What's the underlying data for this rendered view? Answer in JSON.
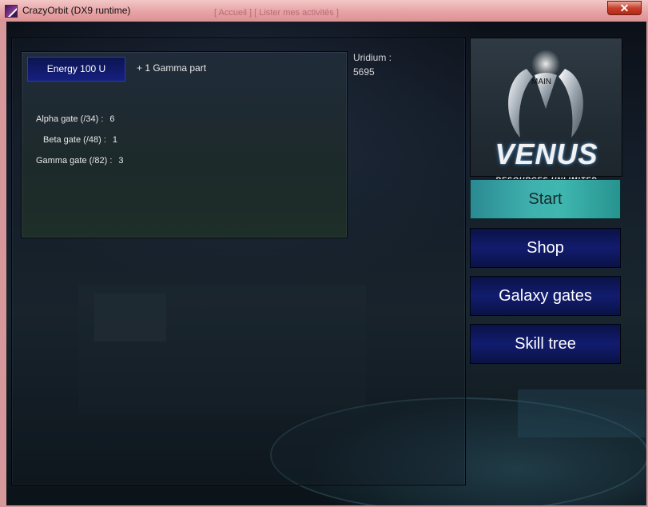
{
  "window": {
    "title": "CrazyOrbit (DX9 runtime)",
    "background_text": "[ Accueil ]  [ Lister mes activités ]",
    "close_symbol": "✕"
  },
  "reward": {
    "button_label": "Energy 100 U",
    "text": "+ 1 Gamma part"
  },
  "gates": [
    {
      "label": "Alpha gate (/34) :",
      "value": "6"
    },
    {
      "label": "Beta gate (/48) :",
      "value": "1"
    },
    {
      "label": "Gamma gate (/82) :",
      "value": "3"
    }
  ],
  "uridium": {
    "label": "Uridium :",
    "value": "5695"
  },
  "logo": {
    "tag": "MAIN",
    "name": "VENUS",
    "subtitle": "RESOURCES UNLIMITED"
  },
  "menu": {
    "start": "Start",
    "shop": "Shop",
    "galaxy_gates": "Galaxy gates",
    "skill_tree": "Skill tree"
  },
  "colors": {
    "active_button": "#3fb0ae",
    "menu_button": "#121c6e",
    "titlebar": "#e7a3a5"
  }
}
